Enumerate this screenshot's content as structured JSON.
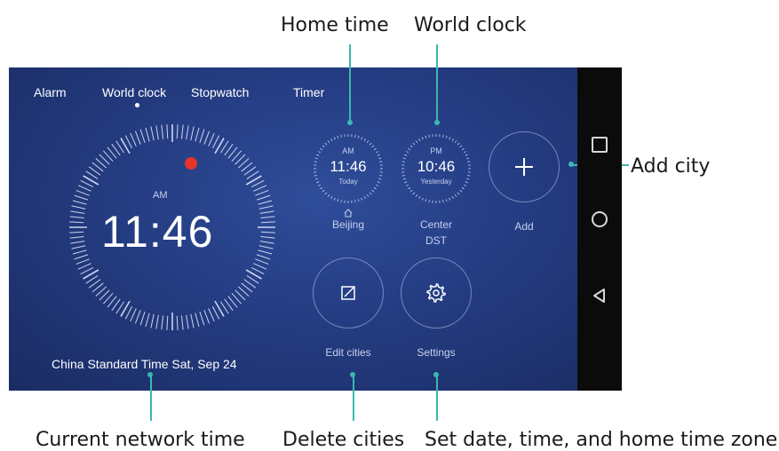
{
  "callouts": {
    "home_time": "Home time",
    "world_clock": "World clock",
    "add_city": "Add city",
    "current_network_time": "Current network time",
    "delete_cities": "Delete cities",
    "set_date_time": "Set date, time, and home time zone"
  },
  "tabs": [
    "Alarm",
    "World clock",
    "Stopwatch",
    "Timer"
  ],
  "main_clock": {
    "ampm": "AM",
    "time": "11:46"
  },
  "bottom_info": "China Standard Time  Sat, Sep 24",
  "cities": [
    {
      "ampm": "AM",
      "time": "11:46",
      "day": "Today",
      "name": "Beijing",
      "extra": ""
    },
    {
      "ampm": "PM",
      "time": "10:46",
      "day": "Yesterday",
      "name": "Center",
      "extra": "DST"
    }
  ],
  "add_label": "Add",
  "edit_label": "Edit cities",
  "settings_label": "Settings",
  "colors": {
    "screen_bg": "#243c82",
    "accent_line": "#3bb8b0",
    "alarm_dot": "#e6352b",
    "navbar_bg": "#0b0b0b"
  },
  "icons": {
    "home": "home-icon",
    "plus": "plus-icon",
    "edit": "edit-icon",
    "settings": "gear-icon",
    "recents": "square-icon",
    "home_nav": "circle-icon",
    "back": "back-triangle-icon"
  }
}
